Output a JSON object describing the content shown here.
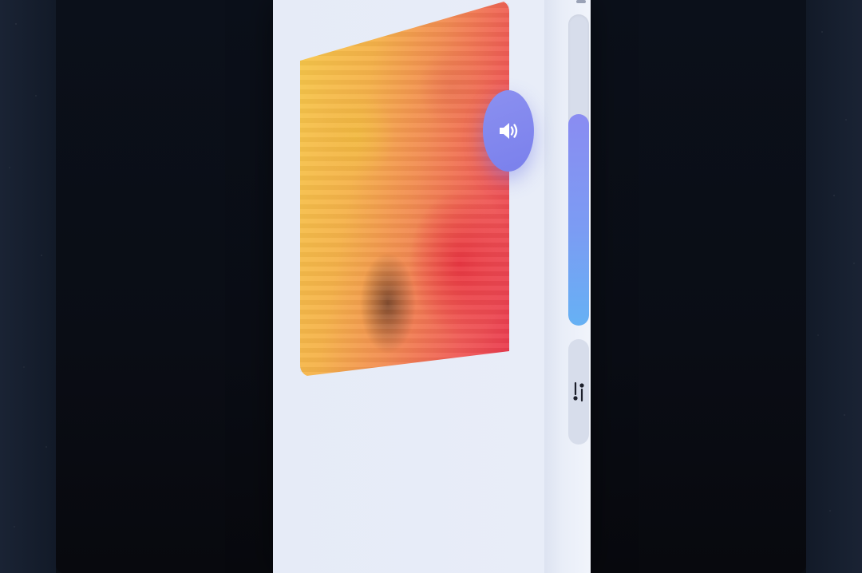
{
  "player": {
    "volume_level": 0.68,
    "album_art_icon": "album-art-image",
    "volume_icon": "speaker-volume-icon",
    "settings_icon": "sliders-settings-icon"
  },
  "colors": {
    "background": "#0d1320",
    "device_surface": "#e8edf8",
    "accent": "#7a80ec",
    "volume_fill_top": "#8a8cf2",
    "volume_fill_bottom": "#66b1f4",
    "track": "#d7ddeb"
  }
}
